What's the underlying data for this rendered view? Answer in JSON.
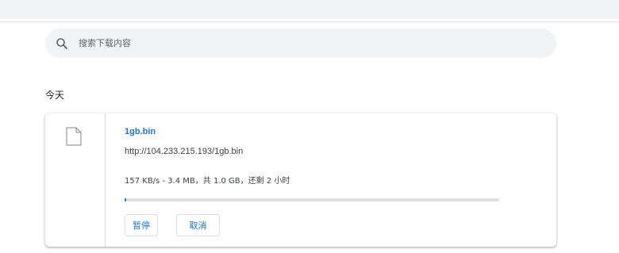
{
  "search": {
    "placeholder": "搜索下载内容",
    "icon": "search-icon"
  },
  "section": {
    "heading": "今天"
  },
  "download": {
    "file_name": "1gb.bin",
    "url": "http://104.233.215.193/1gb.bin",
    "status": "157 KB/s - 3.4 MB，共 1.0 GB，还剩 2 小时",
    "progress_fraction": 0.0034,
    "icon": "file-icon",
    "pause_label": "暂停",
    "cancel_label": "取消"
  },
  "colors": {
    "accent": "#1a73e8",
    "topbar": "#f1f3f4",
    "search_bg": "#f1f3f4",
    "progress_track": "#e0e0e0"
  }
}
